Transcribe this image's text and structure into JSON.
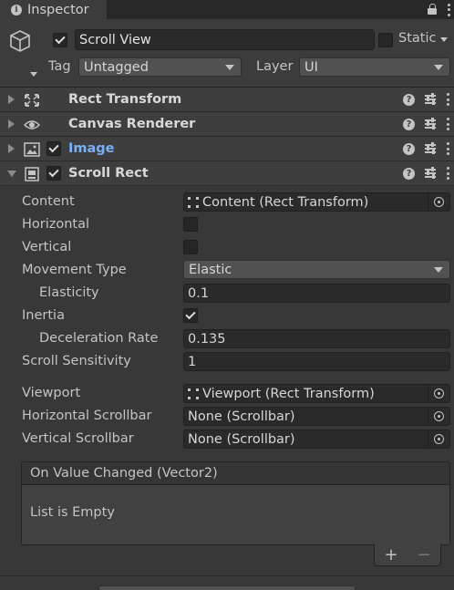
{
  "tab": {
    "title": "Inspector"
  },
  "header": {
    "object_name": "Scroll View",
    "static_label": "Static",
    "tag_label": "Tag",
    "tag_value": "Untagged",
    "layer_label": "Layer",
    "layer_value": "UI"
  },
  "components": [
    {
      "title": "Rect Transform",
      "icon": "rect-transform-icon",
      "expanded": false
    },
    {
      "title": "Canvas Renderer",
      "icon": "eye-icon",
      "expanded": false
    },
    {
      "title": "Image",
      "icon": "image-icon",
      "expanded": false,
      "enabled": true
    },
    {
      "title": "Scroll Rect",
      "icon": "scroll-rect-icon",
      "expanded": true,
      "enabled": true
    }
  ],
  "scroll_rect": {
    "content_label": "Content",
    "content_value": "Content (Rect Transform)",
    "horizontal_label": "Horizontal",
    "horizontal_checked": false,
    "vertical_label": "Vertical",
    "vertical_checked": false,
    "movement_type_label": "Movement Type",
    "movement_type_value": "Elastic",
    "elasticity_label": "Elasticity",
    "elasticity_value": "0.1",
    "inertia_label": "Inertia",
    "inertia_checked": true,
    "deceleration_label": "Deceleration Rate",
    "deceleration_value": "0.135",
    "sensitivity_label": "Scroll Sensitivity",
    "sensitivity_value": "1",
    "viewport_label": "Viewport",
    "viewport_value": "Viewport (Rect Transform)",
    "h_scrollbar_label": "Horizontal Scrollbar",
    "h_scrollbar_value": "None (Scrollbar)",
    "v_scrollbar_label": "Vertical Scrollbar",
    "v_scrollbar_value": "None (Scrollbar)"
  },
  "event": {
    "title": "On Value Changed (Vector2)",
    "empty_text": "List is Empty",
    "add_symbol": "+",
    "remove_symbol": "−"
  },
  "colors": {
    "background": "#383838",
    "header_bg": "#3c3c3c",
    "link_blue": "#7ab0f5"
  }
}
